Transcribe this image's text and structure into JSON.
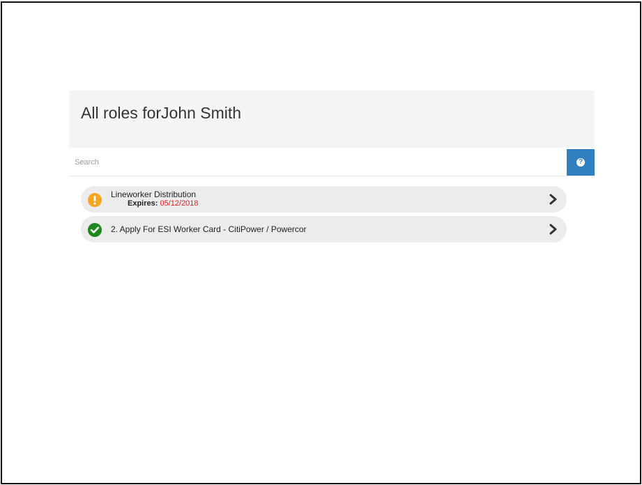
{
  "header": {
    "title_prefix": "All roles for",
    "user_name": "John Smith"
  },
  "search": {
    "placeholder": "Search",
    "value": "",
    "help_icon": "question-circle-icon",
    "accent_color": "#2f7fc1"
  },
  "roles": [
    {
      "label": "Lineworker Distribution",
      "status": "warning",
      "status_icon": "exclamation-circle-icon",
      "status_color": "#f5a623",
      "expires_label": "Expires:",
      "expires_date": "05/12/2018",
      "expires_color": "#e02020"
    },
    {
      "label": "2. Apply For ESI Worker Card - CitiPower / Powercor",
      "status": "complete",
      "status_icon": "check-circle-icon",
      "status_color": "#1e8a1e"
    }
  ]
}
